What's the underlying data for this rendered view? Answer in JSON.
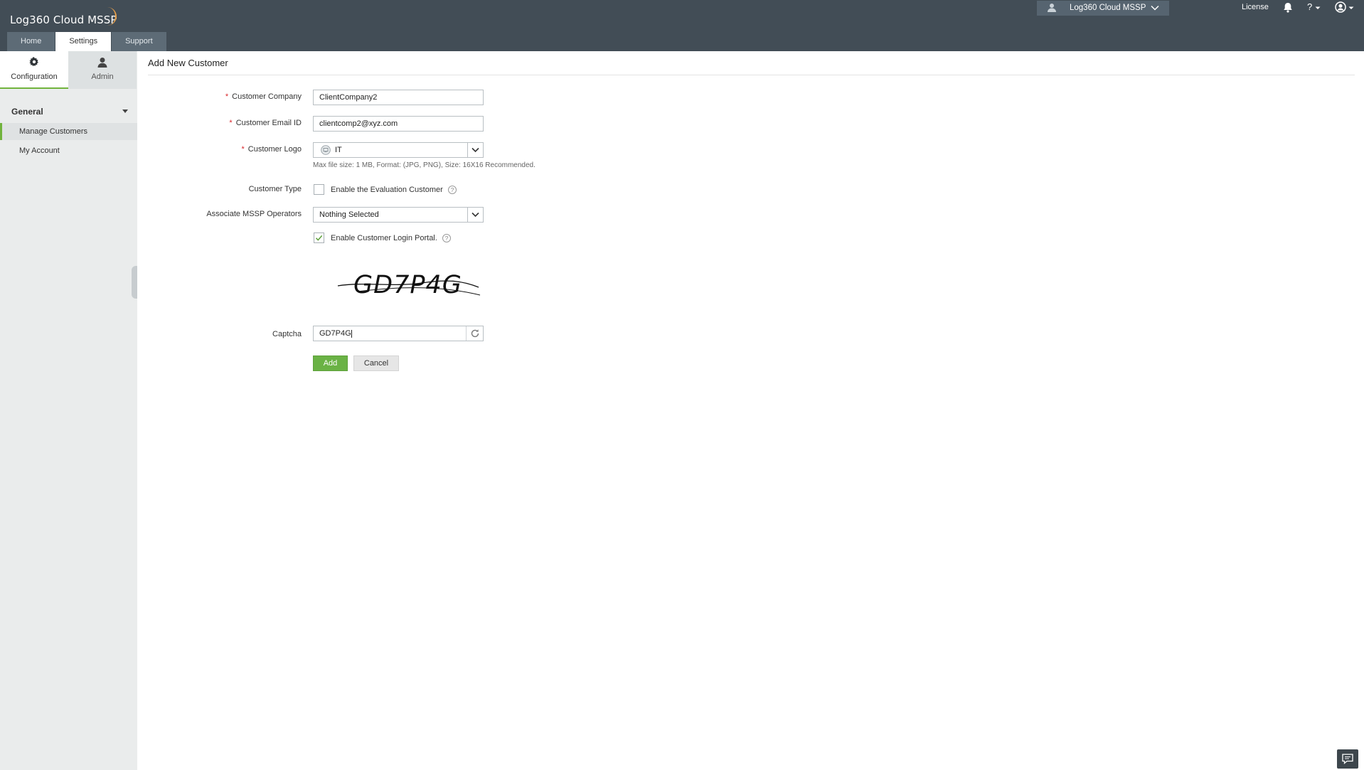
{
  "app": {
    "logo_text": "Log360 Cloud MSSP",
    "mssp_selector": "Log360 Cloud MSSP",
    "license": "License",
    "help": "?"
  },
  "tabs": [
    "Home",
    "Settings",
    "Support"
  ],
  "active_tab": "Settings",
  "left_panel": {
    "tabs": [
      {
        "label": "Configuration",
        "icon": "gear-icon",
        "active": true
      },
      {
        "label": "Admin",
        "icon": "user-icon",
        "active": false
      }
    ],
    "group": "General",
    "items": [
      {
        "label": "Manage Customers",
        "active": true
      },
      {
        "label": "My Account",
        "active": false
      }
    ]
  },
  "form": {
    "title": "Add New Customer",
    "company_label": "Customer Company",
    "company_value": "ClientCompany2",
    "email_label": "Customer Email ID",
    "email_value": "clientcomp2@xyz.com",
    "logo_label": "Customer Logo",
    "logo_value": "IT",
    "logo_hint": "Max file size: 1 MB, Format: (JPG, PNG), Size: 16X16 Recommended.",
    "type_label": "Customer Type",
    "evaluation_label": "Enable the Evaluation Customer",
    "evaluation_checked": false,
    "operators_label": "Associate MSSP Operators",
    "operators_value": "Nothing Selected",
    "portal_label": "Enable Customer Login Portal.",
    "portal_checked": true,
    "captcha_image_text": "GD7P4G",
    "captcha_label": "Captcha",
    "captcha_value": "GD7P4G",
    "required_mark": "*",
    "add_button": "Add",
    "cancel_button": "Cancel"
  },
  "colors": {
    "header": "#424d56",
    "accent": "#6ab245",
    "required": "#d9262a"
  }
}
